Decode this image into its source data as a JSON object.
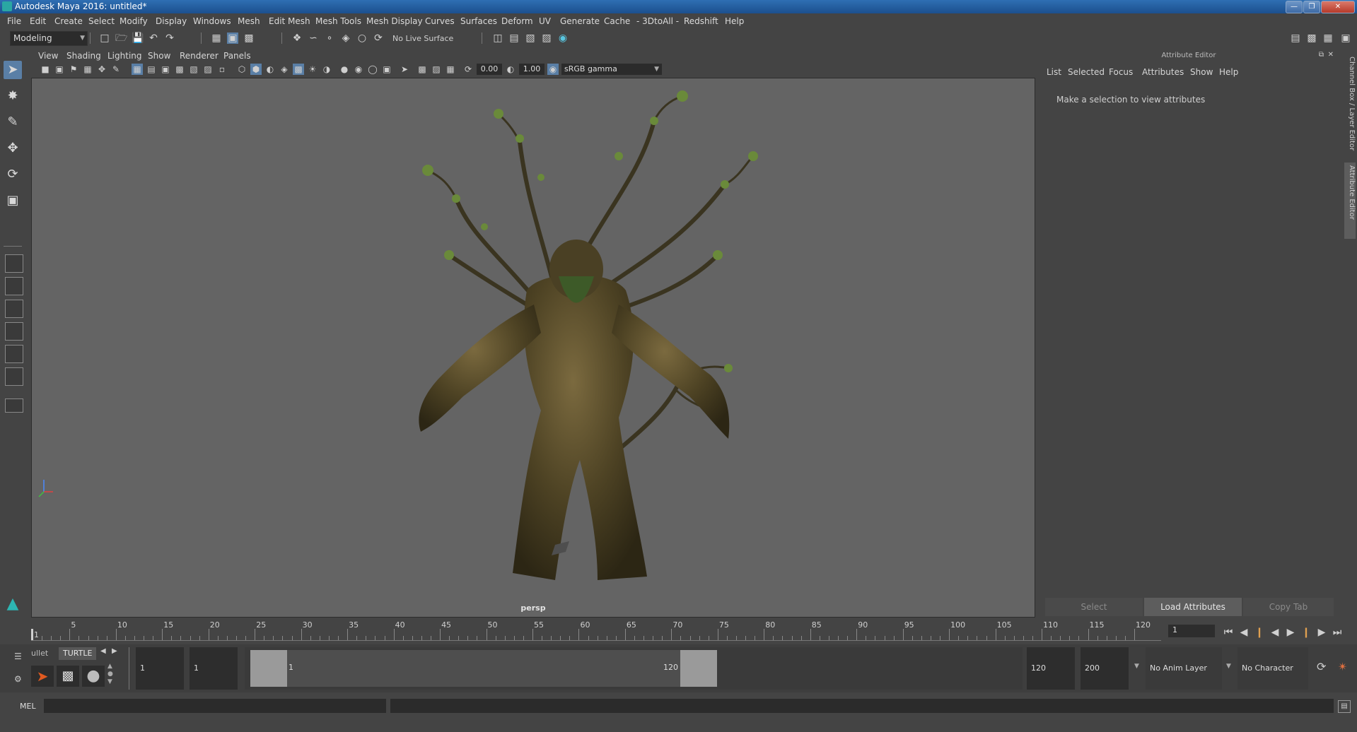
{
  "window": {
    "title": "Autodesk Maya 2016: untitled*"
  },
  "menubar": {
    "items": [
      "File",
      "Edit",
      "Create",
      "Select",
      "Modify",
      "Display",
      "Windows",
      "Mesh",
      "Edit Mesh",
      "Mesh Tools",
      "Mesh Display",
      "Curves",
      "Surfaces",
      "Deform",
      "UV",
      "Generate",
      "Cache",
      "- 3DtoAll -",
      "Redshift",
      "Help"
    ]
  },
  "statusline": {
    "menu_set": "Modeling",
    "live_surface": "No Live Surface"
  },
  "viewport": {
    "menus": [
      "View",
      "Shading",
      "Lighting",
      "Show",
      "Renderer",
      "Panels"
    ],
    "exposure": "0.00",
    "gamma": "1.00",
    "color_space": "sRGB gamma",
    "camera_label": "persp"
  },
  "attribute_editor": {
    "title": "Attribute Editor",
    "menus": [
      "List",
      "Selected",
      "Focus",
      "Attributes",
      "Show",
      "Help"
    ],
    "message": "Make a selection to view attributes",
    "buttons": [
      "Select",
      "Load Attributes",
      "Copy Tab"
    ]
  },
  "side_tabs": [
    "Channel Box / Layer Editor",
    "Attribute Editor"
  ],
  "time_slider": {
    "tick_labels": [
      "1",
      "5",
      "10",
      "15",
      "20",
      "25",
      "30",
      "35",
      "40",
      "45",
      "50",
      "55",
      "60",
      "65",
      "70",
      "75",
      "80",
      "85",
      "90",
      "95",
      "100",
      "105",
      "110",
      "115",
      "120"
    ],
    "current_frame": "1"
  },
  "shelf": {
    "tabs": [
      "ullet",
      "TURTLE"
    ]
  },
  "range_slider": {
    "start_time": "1",
    "playback_start": "1",
    "range_start_label": "1",
    "range_end_label": "120",
    "playback_end": "120",
    "end_time": "200",
    "anim_layer": "No Anim Layer",
    "character_set": "No Character Set"
  },
  "command_line": {
    "label": "MEL"
  }
}
